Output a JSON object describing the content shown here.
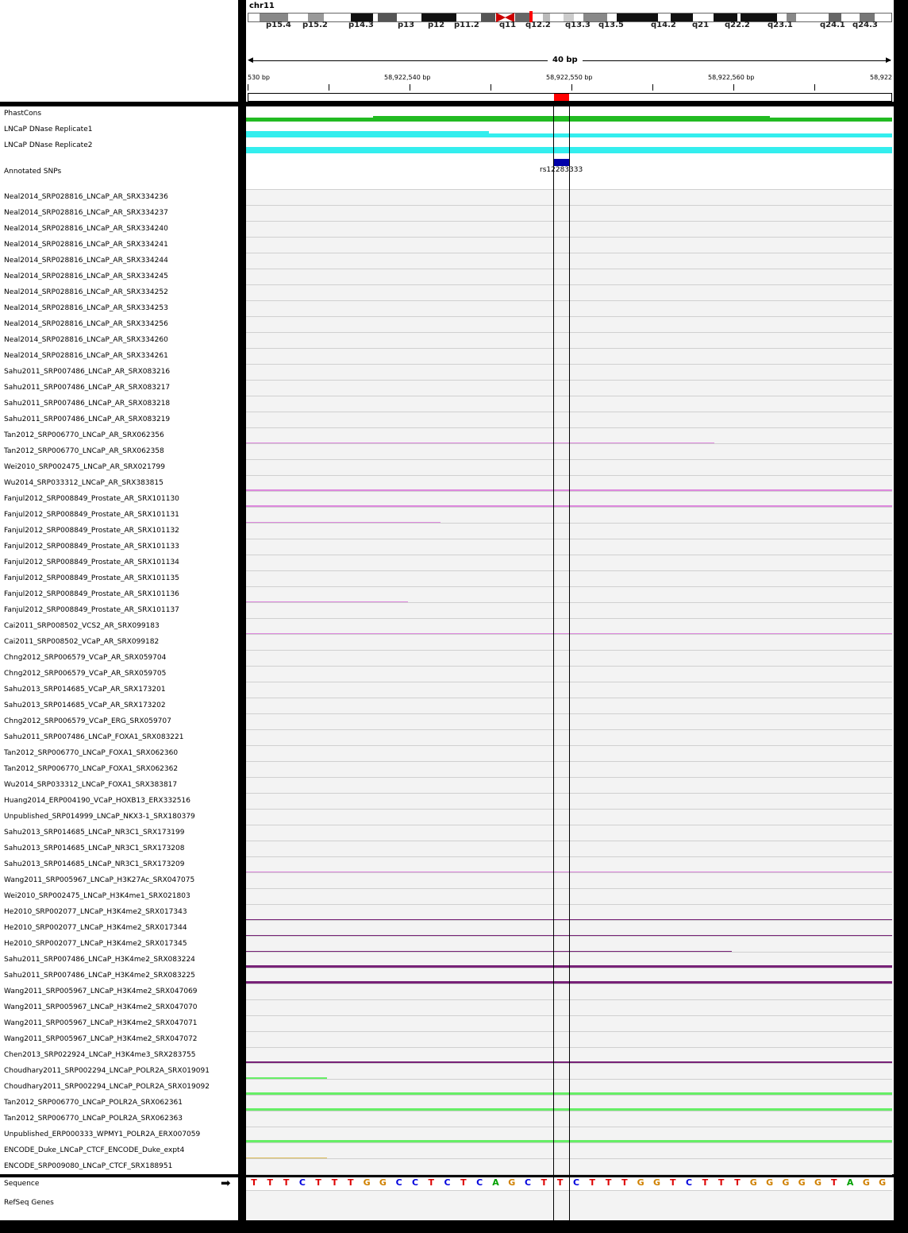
{
  "ideogram": {
    "chromosome": "chr11",
    "bands": [
      "p15.4",
      "p15.2",
      "p14.3",
      "p13",
      "p12",
      "p11.2",
      "q11",
      "q12.2",
      "q13.3",
      "q13.5",
      "q14.2",
      "q21",
      "q22.2",
      "q23.1",
      "q24.1",
      "q24.3"
    ]
  },
  "ruler": {
    "span_label": "40 bp",
    "ticks": [
      "530 bp",
      "58,922,540 bp",
      "58,922,550 bp",
      "58,922,560 bp",
      "58,922"
    ]
  },
  "top_tracks": [
    {
      "name": "PhastCons"
    },
    {
      "name": "LNCaP DNase Replicate1"
    },
    {
      "name": "LNCaP DNase Replicate2"
    },
    {
      "name": "Annotated SNPs"
    }
  ],
  "snp": {
    "id": "rs12283333"
  },
  "tracks": [
    "Neal2014_SRP028816_LNCaP_AR_SRX334236",
    "Neal2014_SRP028816_LNCaP_AR_SRX334237",
    "Neal2014_SRP028816_LNCaP_AR_SRX334240",
    "Neal2014_SRP028816_LNCaP_AR_SRX334241",
    "Neal2014_SRP028816_LNCaP_AR_SRX334244",
    "Neal2014_SRP028816_LNCaP_AR_SRX334245",
    "Neal2014_SRP028816_LNCaP_AR_SRX334252",
    "Neal2014_SRP028816_LNCaP_AR_SRX334253",
    "Neal2014_SRP028816_LNCaP_AR_SRX334256",
    "Neal2014_SRP028816_LNCaP_AR_SRX334260",
    "Neal2014_SRP028816_LNCaP_AR_SRX334261",
    "Sahu2011_SRP007486_LNCaP_AR_SRX083216",
    "Sahu2011_SRP007486_LNCaP_AR_SRX083217",
    "Sahu2011_SRP007486_LNCaP_AR_SRX083218",
    "Sahu2011_SRP007486_LNCaP_AR_SRX083219",
    "Tan2012_SRP006770_LNCaP_AR_SRX062356",
    "Tan2012_SRP006770_LNCaP_AR_SRX062358",
    "Wei2010_SRP002475_LNCaP_AR_SRX021799",
    "Wu2014_SRP033312_LNCaP_AR_SRX383815",
    "Fanjul2012_SRP008849_Prostate_AR_SRX101130",
    "Fanjul2012_SRP008849_Prostate_AR_SRX101131",
    "Fanjul2012_SRP008849_Prostate_AR_SRX101132",
    "Fanjul2012_SRP008849_Prostate_AR_SRX101133",
    "Fanjul2012_SRP008849_Prostate_AR_SRX101134",
    "Fanjul2012_SRP008849_Prostate_AR_SRX101135",
    "Fanjul2012_SRP008849_Prostate_AR_SRX101136",
    "Fanjul2012_SRP008849_Prostate_AR_SRX101137",
    "Cai2011_SRP008502_VCS2_AR_SRX099183",
    "Cai2011_SRP008502_VCaP_AR_SRX099182",
    "Chng2012_SRP006579_VCaP_AR_SRX059704",
    "Chng2012_SRP006579_VCaP_AR_SRX059705",
    "Sahu2013_SRP014685_VCaP_AR_SRX173201",
    "Sahu2013_SRP014685_VCaP_AR_SRX173202",
    "Chng2012_SRP006579_VCaP_ERG_SRX059707",
    "Sahu2011_SRP007486_LNCaP_FOXA1_SRX083221",
    "Tan2012_SRP006770_LNCaP_FOXA1_SRX062360",
    "Tan2012_SRP006770_LNCaP_FOXA1_SRX062362",
    "Wu2014_SRP033312_LNCaP_FOXA1_SRX383817",
    "Huang2014_ERP004190_VCaP_HOXB13_ERX332516",
    "Unpublished_SRP014999_LNCaP_NKX3-1_SRX180379",
    "Sahu2013_SRP014685_LNCaP_NR3C1_SRX173199",
    "Sahu2013_SRP014685_LNCaP_NR3C1_SRX173208",
    "Sahu2013_SRP014685_LNCaP_NR3C1_SRX173209",
    "Wang2011_SRP005967_LNCaP_H3K27Ac_SRX047075",
    "Wei2010_SRP002475_LNCaP_H3K4me1_SRX021803",
    "He2010_SRP002077_LNCaP_H3K4me2_SRX017343",
    "He2010_SRP002077_LNCaP_H3K4me2_SRX017344",
    "He2010_SRP002077_LNCaP_H3K4me2_SRX017345",
    "Sahu2011_SRP007486_LNCaP_H3K4me2_SRX083224",
    "Sahu2011_SRP007486_LNCaP_H3K4me2_SRX083225",
    "Wang2011_SRP005967_LNCaP_H3K4me2_SRX047069",
    "Wang2011_SRP005967_LNCaP_H3K4me2_SRX047070",
    "Wang2011_SRP005967_LNCaP_H3K4me2_SRX047071",
    "Wang2011_SRP005967_LNCaP_H3K4me2_SRX047072",
    "Chen2013_SRP022924_LNCaP_H3K4me3_SRX283755",
    "Choudhary2011_SRP002294_LNCaP_POLR2A_SRX019091",
    "Choudhary2011_SRP002294_LNCaP_POLR2A_SRX019092",
    "Tan2012_SRP006770_LNCaP_POLR2A_SRX062361",
    "Tan2012_SRP006770_LNCaP_POLR2A_SRX062363",
    "Unpublished_ERP000333_WPMY1_POLR2A_ERX007059",
    "ENCODE_Duke_LNCaP_CTCF_ENCODE_Duke_expt4",
    "ENCODE_SRP009080_LNCaP_CTCF_SRX188951"
  ],
  "bottom": {
    "sequence_label": "Sequence",
    "arrow": "➡",
    "refseq_label": "RefSeq Genes",
    "bases": [
      "T",
      "T",
      "T",
      "C",
      "T",
      "T",
      "T",
      "G",
      "G",
      "C",
      "C",
      "T",
      "C",
      "T",
      "C",
      "A",
      "G",
      "C",
      "T",
      "T",
      "C",
      "T",
      "T",
      "T",
      "G",
      "G",
      "T",
      "C",
      "T",
      "T",
      "T",
      "G",
      "G",
      "G",
      "G",
      "G",
      "T",
      "A",
      "G",
      "G"
    ]
  },
  "colors": {
    "phastcons": "#22bb22",
    "dnase": "#33eeee",
    "snp": "#0000aa",
    "ar": "#dd88dd",
    "histone": "#772277",
    "polr2a": "#66ee66",
    "ctcf": "#ddbb55",
    "A": "#00a000",
    "C": "#0000dd",
    "G": "#d08000",
    "T": "#dd0000"
  }
}
